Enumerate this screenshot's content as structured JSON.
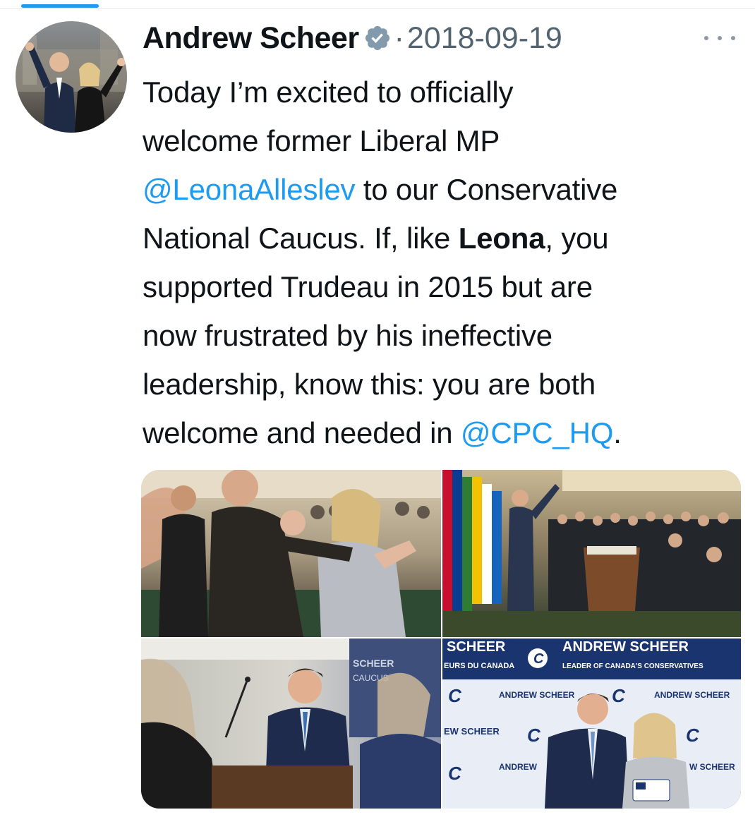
{
  "tweet": {
    "author_name": "Andrew Scheer",
    "separator": "·",
    "timestamp": "2018-09-19",
    "text": {
      "line1": "Today I’m excited to officially",
      "line2": "welcome former Liberal MP",
      "mention1": "@LeonaAlleslev",
      "line3_rest": " to our Conservative",
      "line4_a": "National Caucus. If, like ",
      "line4_bold": "Leona",
      "line4_b": ", you",
      "line5": "supported Trudeau in 2015 but are",
      "line6": "now frustrated by his ineffective",
      "line7": "leadership, know this: you are both",
      "line8_a": "welcome and needed in ",
      "mention2": "@CPC_HQ",
      "line8_b": "."
    },
    "media": {
      "photo3_backdrop_a": "SCHEER",
      "photo3_backdrop_b": "CAUCUS",
      "photo4_banner_top": "SCHEER",
      "photo4_banner_left_sub": "EURS DU CANADA",
      "photo4_banner_name": "ANDREW SCHEER",
      "photo4_banner_sub": "LEADER OF CANADA'S CONSERVATIVES",
      "photo4_name_a": "ANDREW SCHEER",
      "photo4_name_b": "ANDREW SCHEER",
      "photo4_name_c": "EW SCHEER",
      "photo4_name_d": "ANDREW",
      "photo4_name_e": "W SCHEER",
      "photo4_logo": "C"
    }
  },
  "colors": {
    "link": "#1d9bf0",
    "secondary_text": "#536471",
    "verified_badge": "#829aab",
    "accent_tab": "#1d9bf0"
  },
  "icons": {
    "verified": "verified-badge-icon",
    "more": "more-icon"
  }
}
